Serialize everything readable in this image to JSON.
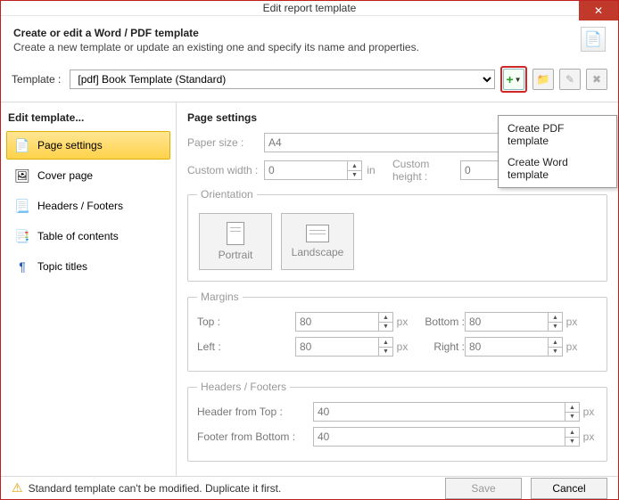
{
  "title": "Edit report template",
  "header": {
    "heading": "Create or edit a Word / PDF template",
    "sub": "Create a new template or update an existing one and specify its name and properties."
  },
  "templateRow": {
    "label": "Template :",
    "selected": "[pdf] Book Template (Standard)"
  },
  "toolbar": {
    "add": "+",
    "folder": "📁",
    "edit": "✎",
    "delete": "✖"
  },
  "menu": {
    "pdf": "Create PDF template",
    "word": "Create Word template"
  },
  "side": {
    "title": "Edit template...",
    "items": [
      {
        "label": "Page settings",
        "icon": "📄"
      },
      {
        "label": "Cover page",
        "icon": "🖼"
      },
      {
        "label": "Headers / Footers",
        "icon": "📃"
      },
      {
        "label": "Table of contents",
        "icon": "📑"
      },
      {
        "label": "Topic titles",
        "icon": "¶"
      }
    ]
  },
  "page": {
    "title": "Page settings",
    "paperLabel": "Paper size :",
    "paperValue": "A4",
    "cwLabel": "Custom width :",
    "cwValue": "0",
    "chLabel": "Custom height :",
    "chValue": "0",
    "unitIn": "in",
    "orientationTitle": "Orientation",
    "portrait": "Portrait",
    "landscape": "Landscape",
    "marginsTitle": "Margins",
    "top": "Top :",
    "topV": "80",
    "bottom": "Bottom :",
    "bottomV": "80",
    "left": "Left :",
    "leftV": "80",
    "right": "Right :",
    "rightV": "80",
    "px": "px",
    "hfTitle": "Headers / Footers",
    "hTop": "Header from Top :",
    "hTopV": "40",
    "fBot": "Footer from Bottom :",
    "fBotV": "40"
  },
  "footer": {
    "warn": "Standard template can't be modified. Duplicate it first.",
    "save": "Save",
    "cancel": "Cancel"
  }
}
